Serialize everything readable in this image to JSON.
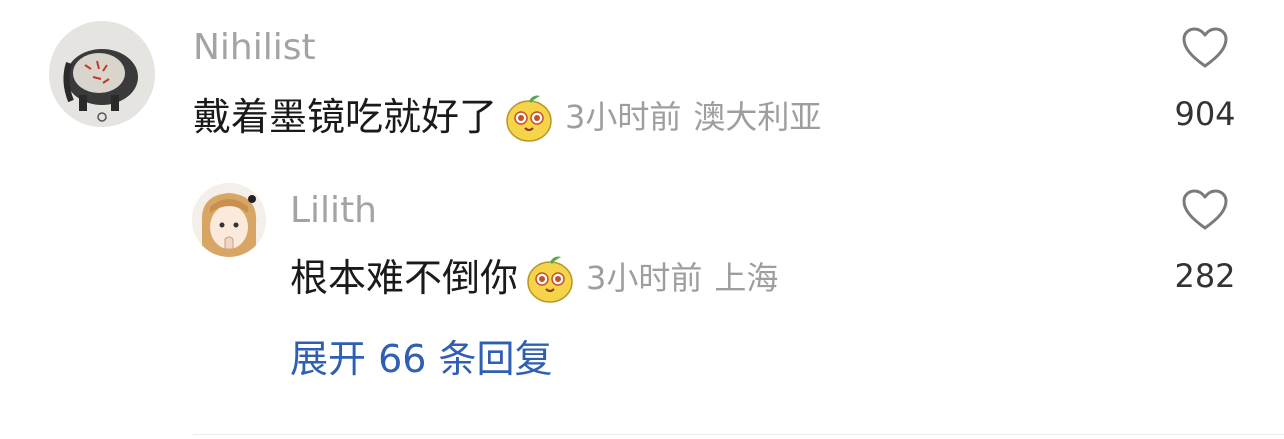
{
  "comments": [
    {
      "username": "Nihilist",
      "text": "戴着墨镜吃就好了",
      "emoji": "pear-face-emoji",
      "time": "3小时前",
      "location": "澳大利亚",
      "likes": "904"
    },
    {
      "username": "Lilith",
      "text": "根本难不倒你",
      "emoji": "pear-face-emoji",
      "time": "3小时前",
      "location": "上海",
      "likes": "282"
    }
  ],
  "replies": {
    "expand_label": "展开 66 条回复"
  },
  "colors": {
    "username": "#a3a3a3",
    "text": "#1a1a1a",
    "meta": "#9e9e9e",
    "link": "#2f5fb2",
    "heart_outline": "#7a7a7a"
  }
}
